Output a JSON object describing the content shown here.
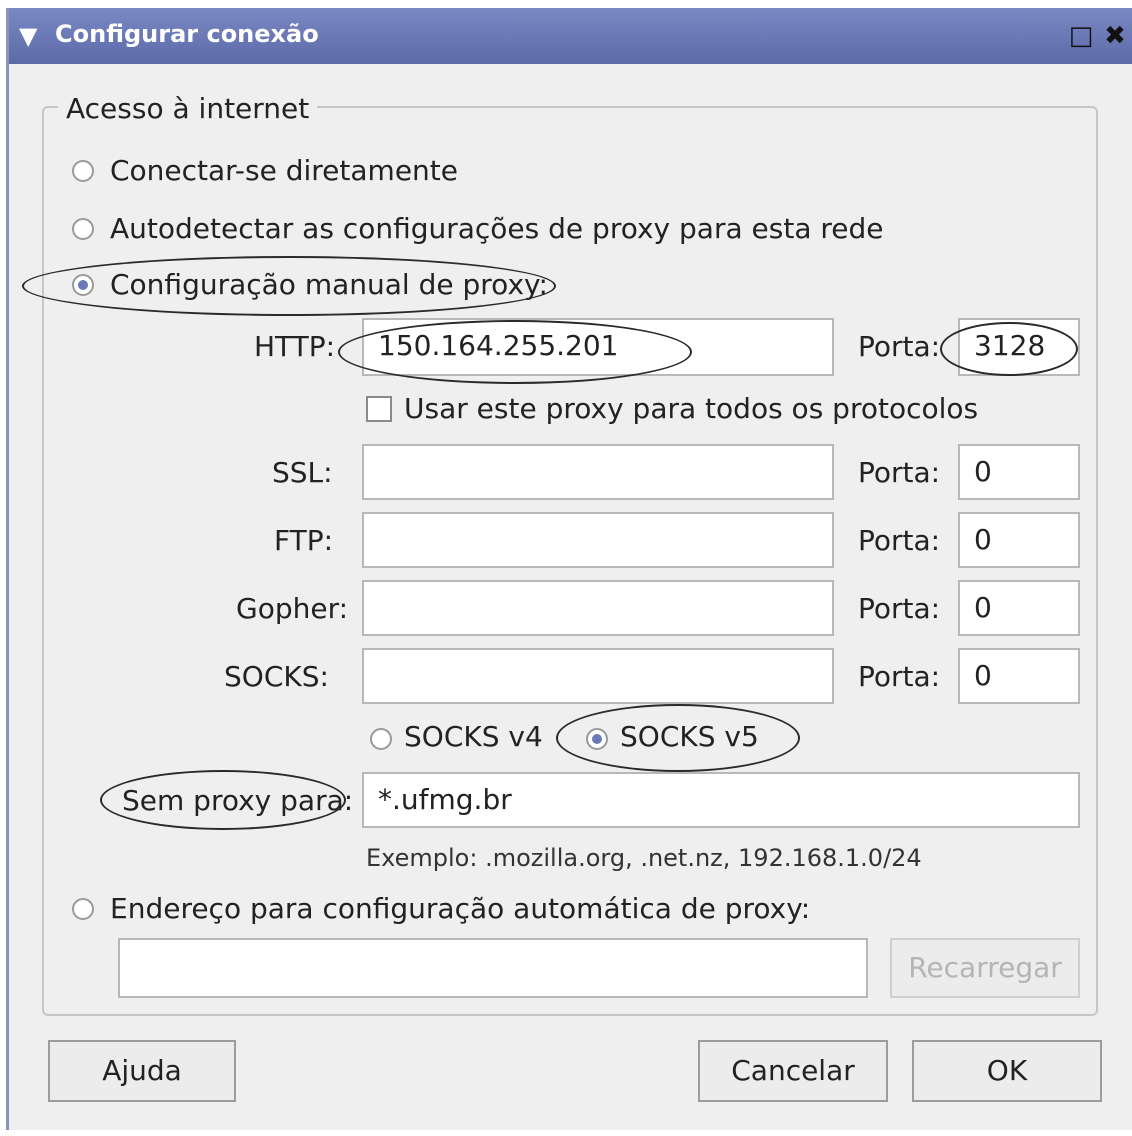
{
  "window": {
    "title": "Configurar conexão",
    "collapse_icon": "chevron-down-icon",
    "maximize_icon": "maximize-icon",
    "close_icon": "close-icon"
  },
  "group": {
    "legend": "Acesso à internet",
    "options": {
      "direct": "Conectar-se diretamente",
      "autodetect": "Autodetectar as configurações de proxy para esta rede",
      "manual": "Configuração manual de proxy:",
      "auto_url": "Endereço para configuração automática de proxy:"
    },
    "selected_option": "manual"
  },
  "proxies": {
    "port_label": "Porta:",
    "http": {
      "label": "HTTP:",
      "value": "150.164.255.201",
      "port": "3128"
    },
    "use_all_label": "Usar este proxy para todos os protocolos",
    "ssl": {
      "label": "SSL:",
      "value": "",
      "port": "0"
    },
    "ftp": {
      "label": "FTP:",
      "value": "",
      "port": "0"
    },
    "gopher": {
      "label": "Gopher:",
      "value": "",
      "port": "0"
    },
    "socks": {
      "label": "SOCKS:",
      "value": "",
      "port": "0"
    }
  },
  "socks_version": {
    "v4": "SOCKS v4",
    "v5": "SOCKS v5",
    "selected": "v5"
  },
  "no_proxy": {
    "label": "Sem proxy para:",
    "value": "*.ufmg.br",
    "example": "Exemplo: .mozilla.org, .net.nz, 192.168.1.0/24"
  },
  "auto_url_field": {
    "value": ""
  },
  "reload_button": "Recarregar",
  "buttons": {
    "help": "Ajuda",
    "cancel": "Cancelar",
    "ok": "OK"
  }
}
